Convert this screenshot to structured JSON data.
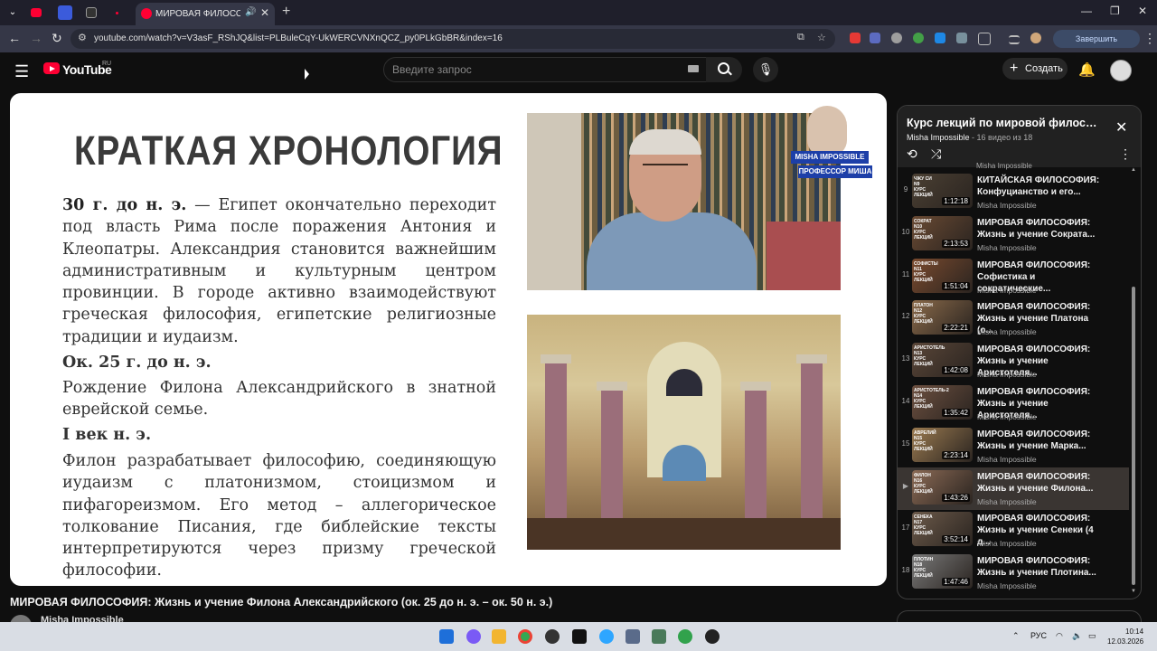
{
  "browser": {
    "tab_title": "МИРОВАЯ ФИЛОСОФИЯ:",
    "url": "youtube.com/watch?v=V3asF_RShJQ&list=PLBuleCqY-UkWERCVNXnQCZ_py0PLkGbBR&index=16",
    "update_label": "Завершить обновление"
  },
  "youtube": {
    "logo_text": "YouTube",
    "region": "RU",
    "search_placeholder": "Введите запрос",
    "create_label": "Создать"
  },
  "slide": {
    "title": "КРАТКАЯ ХРОНОЛОГИЯ",
    "p1_bold": "30 г. до н. э.",
    "p1_rest": " — Египет окончательно переходит под власть Рима после поражения Антония и Клеопатры. Александрия становится важнейшим административным и культурным центром провинции. В городе активно взаимодействуют греческая философия, египетские религиозные традиции и иудаизм.",
    "h2": "Ок. 25 г. до н. э.",
    "p2": "Рождение Филона Александрийского в знатной еврейской семье.",
    "h3": "I век н. э.",
    "p3": "Филон разрабатывает философию, соединяющую иудаизм с платонизмом, стоицизмом и пифагореизмом. Его метод – аллегорическое толкование Писания, где библейские тексты интерпретируются через призму греческой философии.",
    "badge1": "MISHA IMPOSSIBLE",
    "badge2": "ПРОФЕССОР МИША"
  },
  "video": {
    "title": "МИРОВАЯ ФИЛОСОФИЯ: Жизнь и учение Филона Александрийского (ок. 25 до н. э. – ок. 50 н. э.)",
    "channel": "Misha Impossible"
  },
  "playlist": {
    "title": "Курс лекций по мировой философ...",
    "channel": "Misha Impossible",
    "meta": " - 16 видео из 18",
    "prev_channel": "Misha Impossible",
    "items": [
      {
        "index": "9",
        "title": "КИТАЙСКАЯ ФИЛОСОФИЯ: Конфуцианство и его...",
        "channel": "Misha Impossible",
        "duration": "1:12:18",
        "thumb_label": "ЧЖУ СИ\nN9\nКУРС\nЛЕКЦИЙ",
        "thumb_color": "#4b4033"
      },
      {
        "index": "10",
        "title": "МИРОВАЯ ФИЛОСОФИЯ: Жизнь и учение Сократа...",
        "channel": "Misha Impossible",
        "duration": "2:13:53",
        "thumb_label": "СОКРАТ\nN10\nКУРС\nЛЕКЦИЙ",
        "thumb_color": "#6a4a33"
      },
      {
        "index": "11",
        "title": "МИРОВАЯ ФИЛОСОФИЯ: Софистика и сократические...",
        "channel": "Misha Impossible",
        "duration": "1:51:04",
        "thumb_label": "СОФИСТЫ\nN11\nКУРС\nЛЕКЦИЙ",
        "thumb_color": "#7a4a2e"
      },
      {
        "index": "12",
        "title": "МИРОВАЯ ФИЛОСОФИЯ: Жизнь и учение Платона (о...",
        "channel": "Misha Impossible",
        "duration": "2:22:21",
        "thumb_label": "ПЛАТОН\nN12\nКУРС\nЛЕКЦИЙ",
        "thumb_color": "#8a6a4a"
      },
      {
        "index": "13",
        "title": "МИРОВАЯ ФИЛОСОФИЯ: Жизнь и учение Аристотеля...",
        "channel": "Misha Impossible",
        "duration": "1:42:08",
        "thumb_label": "АРИСТОТЕЛЬ\nN13\nКУРС\nЛЕКЦИЙ",
        "thumb_color": "#5a4638"
      },
      {
        "index": "14",
        "title": "МИРОВАЯ ФИЛОСОФИЯ: Жизнь и учение Аристотеля...",
        "channel": "Misha Impossible",
        "duration": "1:35:42",
        "thumb_label": "АРИСТОТЕЛЬ-2\nN14\nКУРС\nЛЕКЦИЙ",
        "thumb_color": "#6d5040"
      },
      {
        "index": "15",
        "title": "МИРОВАЯ ФИЛОСОФИЯ: Жизнь и учение Марка...",
        "channel": "Misha Impossible",
        "duration": "2:23:14",
        "thumb_label": "АВРЕЛИЙ\nN15\nКУРС\nЛЕКЦИЙ",
        "thumb_color": "#9a7a50"
      },
      {
        "index": "▶",
        "title": "МИРОВАЯ ФИЛОСОФИЯ: Жизнь и учение Филона...",
        "channel": "Misha Impossible",
        "duration": "1:43:26",
        "thumb_label": "ФИЛОН\nN16\nКУРС\nЛЕКЦИЙ",
        "thumb_color": "#8b6a55"
      },
      {
        "index": "17",
        "title": "МИРОВАЯ ФИЛОСОФИЯ: Жизнь и учение Сенеки (4 д...",
        "channel": "Misha Impossible",
        "duration": "3:52:14",
        "thumb_label": "СЕНЕКА\nN17\nКУРС\nЛЕКЦИЙ",
        "thumb_color": "#6c5a4a"
      },
      {
        "index": "18",
        "title": "МИРОВАЯ ФИЛОСОФИЯ: Жизнь и учение Плотина...",
        "channel": "Misha Impossible",
        "duration": "1:47:46",
        "thumb_label": "ПЛОТИН\nN18\nКУРС\nЛЕКЦИЙ",
        "thumb_color": "#7a7a7a"
      }
    ]
  },
  "taskbar": {
    "lang": "РУС",
    "time": "10:14",
    "date": "12.03.2026"
  },
  "colors": {
    "accent": "#ff0033",
    "playlist_current": "#3a3532",
    "taskbar": "#d9dde4"
  }
}
